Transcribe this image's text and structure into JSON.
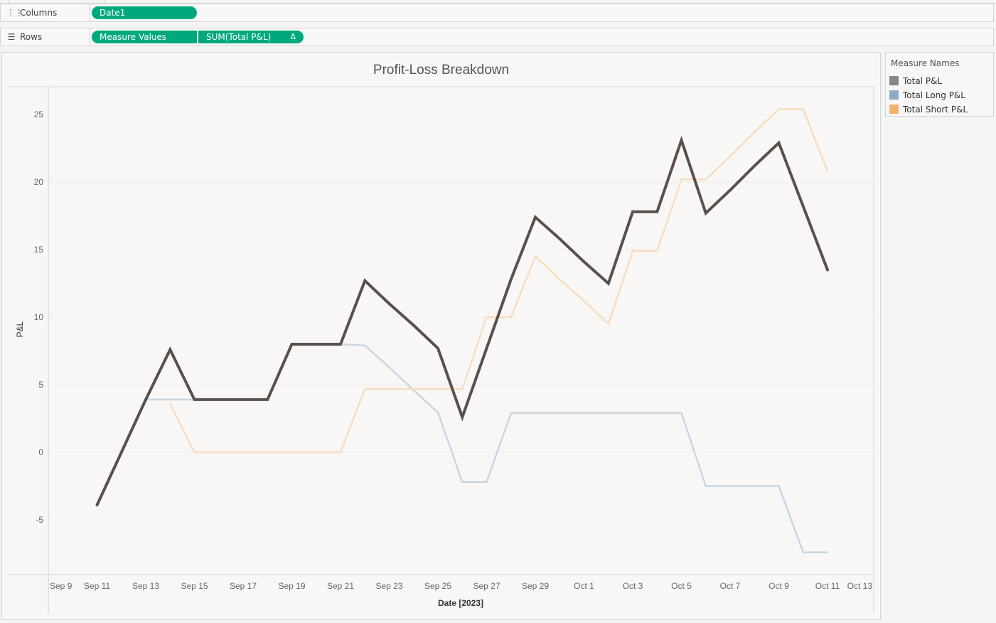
{
  "shelves": {
    "columns": {
      "label": "Columns",
      "icon": "columns-icon",
      "pills": [
        "Date1"
      ]
    },
    "rows": {
      "label": "Rows",
      "icon": "rows-icon",
      "pills": [
        "Measure Values",
        "SUM(Total P&L)"
      ],
      "delta_symbol": "Δ"
    }
  },
  "pill_color": "#00a97d",
  "legend": {
    "title": "Measure Names",
    "items": [
      {
        "label": "Total P&L",
        "color": "#8c8583"
      },
      {
        "label": "Total Long P&L",
        "color": "#8ea9c8"
      },
      {
        "label": "Total Short P&L",
        "color": "#f5b26f"
      }
    ]
  },
  "chart_data": {
    "type": "line",
    "title": "Profit-Loss Breakdown",
    "xlabel": "Date [2023]",
    "ylabel": "P&L",
    "ylim": [
      -9,
      27
    ],
    "yticks": [
      -5,
      0,
      5,
      10,
      15,
      20,
      25
    ],
    "xlim_days": [
      0,
      34
    ],
    "x_tick_labels": [
      "Sep 9",
      "Sep 11",
      "Sep 13",
      "Sep 15",
      "Sep 17",
      "Sep 19",
      "Sep 21",
      "Sep 23",
      "Sep 25",
      "Sep 27",
      "Sep 29",
      "Oct 1",
      "Oct 3",
      "Oct 5",
      "Oct 7",
      "Oct 9",
      "Oct 11",
      "Oct 13"
    ],
    "grid": true,
    "legend_position": "right",
    "series": [
      {
        "name": "Total P&L",
        "color": "#59504e",
        "x": [
          "Sep 11",
          "Sep 12",
          "Sep 13",
          "Sep 14",
          "Sep 15",
          "Sep 16",
          "Sep 17",
          "Sep 18",
          "Sep 19",
          "Sep 20",
          "Sep 21",
          "Sep 22",
          "Sep 23",
          "Sep 24",
          "Sep 25",
          "Sep 26",
          "Sep 27",
          "Sep 28",
          "Sep 29",
          "Sep 30",
          "Oct 1",
          "Oct 2",
          "Oct 3",
          "Oct 4",
          "Oct 5",
          "Oct 6",
          "Oct 7",
          "Oct 8",
          "Oct 9",
          "Oct 10",
          "Oct 11"
        ],
        "values": [
          -3.9,
          0.0,
          3.9,
          7.6,
          3.9,
          3.9,
          3.9,
          3.9,
          8.0,
          8.0,
          8.0,
          12.7,
          11.0,
          9.4,
          7.7,
          2.6,
          7.7,
          12.8,
          17.4,
          15.8,
          14.1,
          12.5,
          17.8,
          17.8,
          23.1,
          17.7,
          19.4,
          21.2,
          22.9,
          18.2,
          13.5
        ]
      },
      {
        "name": "Total Long P&L",
        "color": "#c8d6e3",
        "x": [
          "Sep 13",
          "Sep 14",
          "Sep 15",
          "Sep 16",
          "Sep 17",
          "Sep 18",
          "Sep 19",
          "Sep 20",
          "Sep 21",
          "Sep 22",
          "Sep 23",
          "Sep 24",
          "Sep 25",
          "Sep 26",
          "Sep 27",
          "Sep 28",
          "Sep 29",
          "Sep 30",
          "Oct 1",
          "Oct 2",
          "Oct 3",
          "Oct 4",
          "Oct 5",
          "Oct 6",
          "Oct 7",
          "Oct 8",
          "Oct 9",
          "Oct 10",
          "Oct 11"
        ],
        "values": [
          3.9,
          3.9,
          3.9,
          3.9,
          3.9,
          3.9,
          8.0,
          8.0,
          8.0,
          7.9,
          6.3,
          4.6,
          2.95,
          -2.2,
          -2.2,
          2.9,
          2.9,
          2.9,
          2.9,
          2.9,
          2.9,
          2.9,
          2.9,
          -2.5,
          -2.5,
          -2.5,
          -2.5,
          -7.4,
          -7.4
        ]
      },
      {
        "name": "Total Short P&L",
        "color": "#f8dcc0",
        "x": [
          "Sep 14",
          "Sep 15",
          "Sep 16",
          "Sep 17",
          "Sep 18",
          "Sep 19",
          "Sep 20",
          "Sep 21",
          "Sep 22",
          "Sep 23",
          "Sep 24",
          "Sep 25",
          "Sep 26",
          "Sep 27",
          "Sep 28",
          "Sep 29",
          "Sep 30",
          "Oct 1",
          "Oct 2",
          "Oct 3",
          "Oct 4",
          "Oct 5",
          "Oct 6",
          "Oct 7",
          "Oct 8",
          "Oct 9",
          "Oct 10",
          "Oct 11"
        ],
        "values": [
          3.6,
          0.0,
          0.0,
          0.0,
          0.0,
          0.0,
          0.0,
          0.0,
          4.7,
          4.7,
          4.7,
          4.7,
          4.7,
          10.0,
          10.0,
          14.5,
          12.8,
          11.2,
          9.5,
          14.9,
          14.9,
          20.2,
          20.2,
          21.9,
          23.7,
          25.4,
          25.4,
          20.8
        ]
      }
    ]
  }
}
